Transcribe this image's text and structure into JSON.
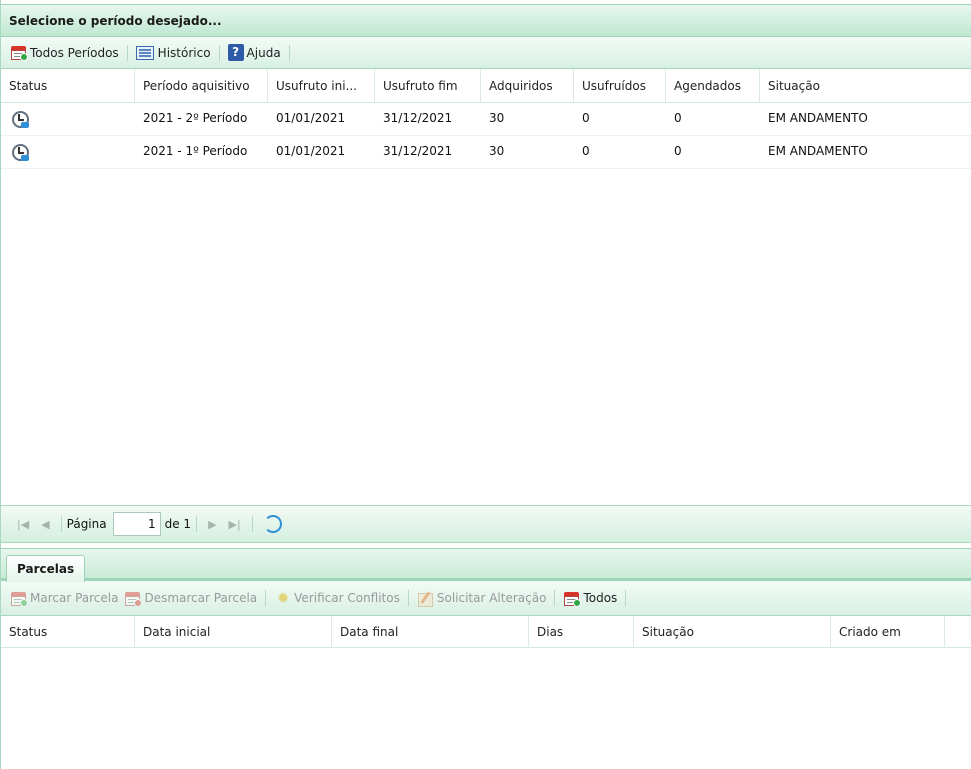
{
  "top_panel": {
    "title": "Selecione o período desejado...",
    "toolbar": {
      "todos_periodos": "Todos Períodos",
      "historico": "Histórico",
      "ajuda": "Ajuda"
    },
    "columns": [
      "Status",
      "Período aquisitivo",
      "Usufruto ini...",
      "Usufruto fim",
      "Adquiridos",
      "Usufruídos",
      "Agendados",
      "Situação"
    ],
    "rows": [
      {
        "status_icon": "clock-arrow-icon",
        "periodo": "2021 - 2º Período",
        "ini": "01/01/2021",
        "fim": "31/12/2021",
        "adquiridos": "30",
        "usufruidos": "0",
        "agendados": "0",
        "situacao": "EM ANDAMENTO"
      },
      {
        "status_icon": "clock-arrow-icon",
        "periodo": "2021 - 1º Período",
        "ini": "01/01/2021",
        "fim": "31/12/2021",
        "adquiridos": "30",
        "usufruidos": "0",
        "agendados": "0",
        "situacao": "EM ANDAMENTO"
      }
    ],
    "pager": {
      "page_label": "Página",
      "page_value": "1",
      "of_label": "de 1"
    }
  },
  "bottom_panel": {
    "tab": "Parcelas",
    "toolbar": {
      "marcar": "Marcar Parcela",
      "desmarcar": "Desmarcar Parcela",
      "verificar": "Verificar Conflitos",
      "solicitar": "Solicitar Alteração",
      "todos": "Todos"
    },
    "columns": [
      "Status",
      "Data inicial",
      "Data final",
      "Dias",
      "Situação",
      "Criado em"
    ]
  },
  "colors": {
    "header_green": "#bfe7d2",
    "border_green": "#9fd3b8",
    "status_blue": "#2f8fd8"
  }
}
